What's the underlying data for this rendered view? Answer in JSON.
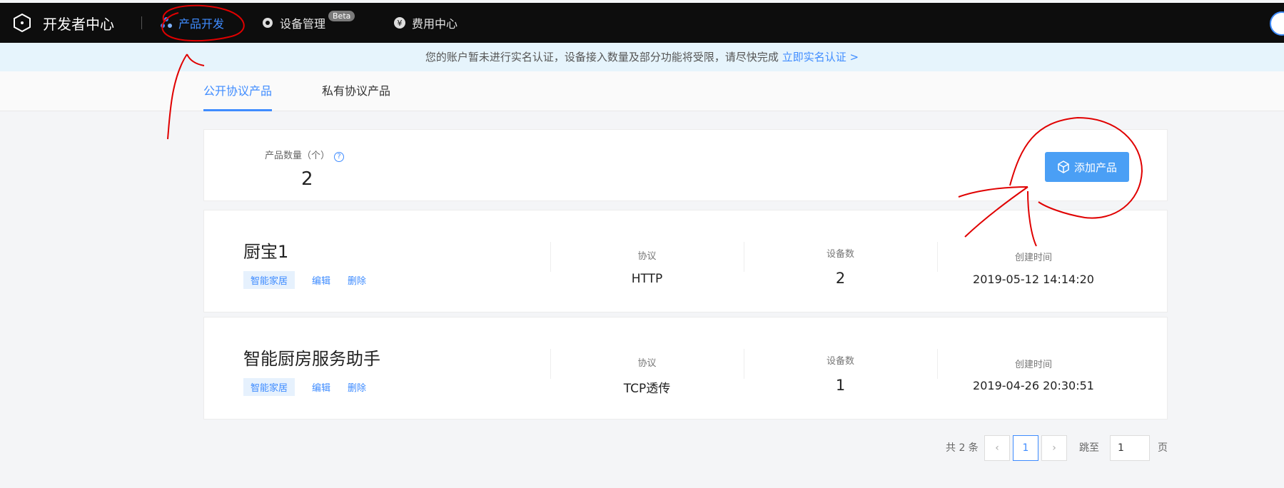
{
  "topnav": {
    "brand": "开发者中心",
    "items": [
      {
        "label": "产品开发",
        "icon": "product-dev-icon",
        "active": true
      },
      {
        "label": "设备管理",
        "icon": "device-manage-icon",
        "badge": "Beta"
      },
      {
        "label": "费用中心",
        "icon": "yen-icon"
      }
    ]
  },
  "notice": {
    "text": "您的账户暂未进行实名认证，设备接入数量及部分功能将受限，请尽快完成",
    "link": "立即实名认证 >"
  },
  "tabs": [
    {
      "label": "公开协议产品",
      "active": true
    },
    {
      "label": "私有协议产品"
    }
  ],
  "summary": {
    "label": "产品数量（个）",
    "help": "?",
    "count": "2",
    "add_button": "添加产品"
  },
  "columns": {
    "protocol": "协议",
    "devices": "设备数",
    "created": "创建时间"
  },
  "products": [
    {
      "name": "厨宝1",
      "tag": "智能家居",
      "edit": "编辑",
      "delete": "删除",
      "protocol": "HTTP",
      "devices": "2",
      "created": "2019-05-12 14:14:20"
    },
    {
      "name": "智能厨房服务助手",
      "tag": "智能家居",
      "edit": "编辑",
      "delete": "删除",
      "protocol": "TCP透传",
      "devices": "1",
      "created": "2019-04-26 20:30:51"
    }
  ],
  "pagination": {
    "total": "共 2 条",
    "prev": "‹",
    "current": "1",
    "next": "›",
    "goto_label": "跳至",
    "goto_value": "1",
    "page_suffix": "页"
  },
  "colors": {
    "accent": "#3f8cff",
    "nav_bg": "#0d0d0d",
    "annotation": "#e00000"
  }
}
